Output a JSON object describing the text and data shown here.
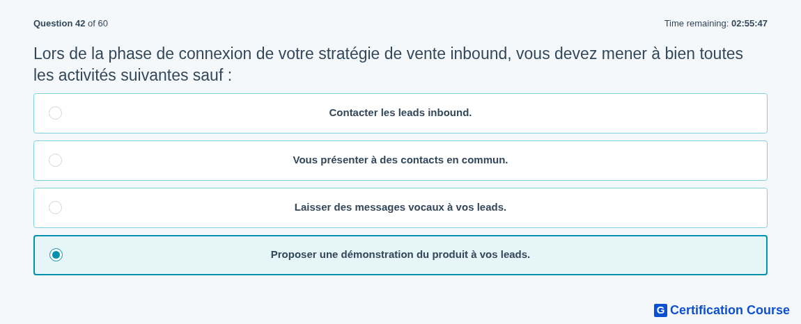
{
  "header": {
    "progress": "**Question 42** of 60",
    "timer": "Time remaining: **02:55:47**"
  },
  "question": "Lors de la phase de connexion de votre stratégie de vente inbound, vous devez mener à bien toutes les activités suivantes sauf :",
  "options": [
    {
      "label": "Contacter les leads inbound.",
      "selected": false
    },
    {
      "label": "Vous présenter à des contacts en commun.",
      "selected": false
    },
    {
      "label": "Laisser des messages vocaux à vos leads.",
      "selected": false
    },
    {
      "label": "Proposer une démonstration du produit à vos leads.",
      "selected": true
    }
  ],
  "brand": {
    "letter": "G",
    "name": "Certification Course"
  }
}
